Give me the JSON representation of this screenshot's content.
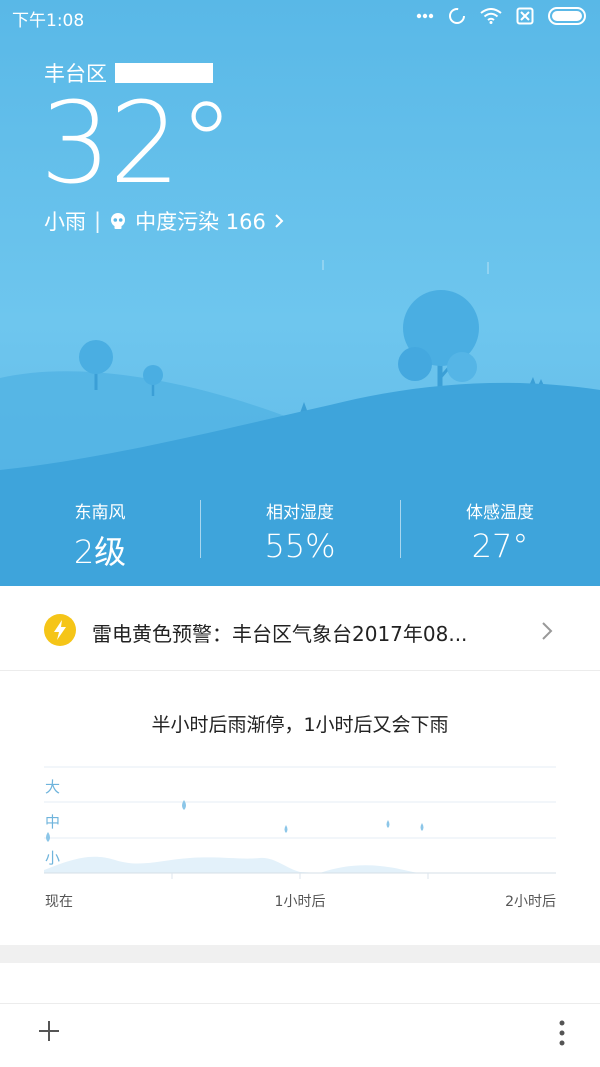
{
  "status_bar": {
    "time": "下午1:08",
    "icons": [
      "more-dots-icon",
      "sync-icon",
      "wifi-icon",
      "sim-off-icon",
      "battery-icon"
    ]
  },
  "current": {
    "location": "丰台区",
    "temperature": "32°",
    "condition": "小雨",
    "divider": "|",
    "air_quality": "中度污染 166",
    "air_icon": "skull-icon"
  },
  "stats": [
    {
      "label": "东南风",
      "value": "2级"
    },
    {
      "label": "相对湿度",
      "value": "55%"
    },
    {
      "label": "体感温度",
      "value": "27°"
    }
  ],
  "alert": {
    "icon": "lightning-icon",
    "text": "雷电黄色预警：丰台区气象台2017年08...",
    "color": "#f5c518"
  },
  "precip": {
    "summary": "半小时后雨渐停，1小时后又会下雨",
    "levels": [
      "大",
      "中",
      "小"
    ],
    "time_labels": [
      "现在",
      "1小时后",
      "2小时后"
    ]
  },
  "colors": {
    "sky_top": "#59b8e7",
    "hill_dark": "#3ea4db",
    "accent_text": "#6fb4dc",
    "chart_fill": "#e3f1fa"
  },
  "bottom_bar": {
    "add_icon": "plus-icon",
    "more_icon": "vertical-dots-icon"
  }
}
